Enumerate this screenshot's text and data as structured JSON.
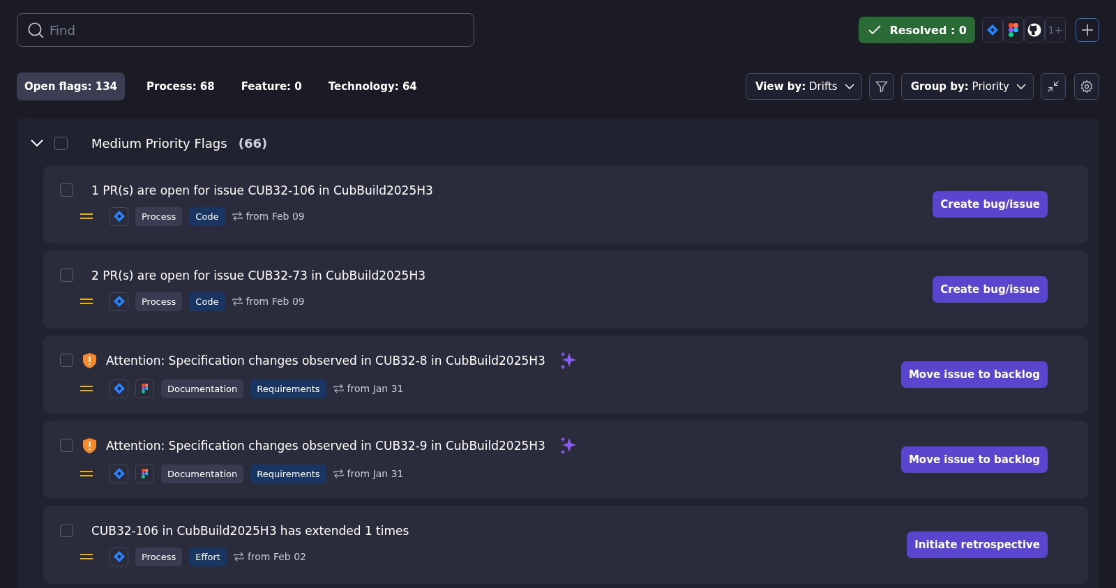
{
  "search": {
    "placeholder": "Find"
  },
  "resolved": {
    "label": "Resolved : 0"
  },
  "integrations": {
    "tools": [
      {
        "kind": "jira"
      },
      {
        "kind": "figma"
      },
      {
        "kind": "github"
      }
    ],
    "more": "1+"
  },
  "tabs": [
    {
      "label": "Open flags: 134",
      "selected": true
    },
    {
      "label": "Process: 68",
      "selected": false
    },
    {
      "label": "Feature: 0",
      "selected": false
    },
    {
      "label": "Technology: 64",
      "selected": false
    }
  ],
  "view_by": {
    "label": "View by:",
    "value": "Drifts"
  },
  "group_by": {
    "label": "Group by:",
    "value": "Priority"
  },
  "group": {
    "title": "Medium Priority Flags",
    "count": "(66)",
    "expanded": true,
    "checked": false,
    "flags": [
      {
        "title": "1 PR(s) are open for issue CUB32-106 in CubBuild2025H3",
        "checked": false,
        "attention": false,
        "ai": false,
        "sources": [
          {
            "kind": "jira"
          }
        ],
        "tags": [
          {
            "label": "Process",
            "kind": "category"
          },
          {
            "label": "Code",
            "kind": "type"
          }
        ],
        "since": "from Feb 09",
        "action": "Create bug/issue"
      },
      {
        "title": "2 PR(s) are open for issue CUB32-73 in CubBuild2025H3",
        "checked": false,
        "attention": false,
        "ai": false,
        "sources": [
          {
            "kind": "jira"
          }
        ],
        "tags": [
          {
            "label": "Process",
            "kind": "category"
          },
          {
            "label": "Code",
            "kind": "type"
          }
        ],
        "since": "from Feb 09",
        "action": "Create bug/issue"
      },
      {
        "title": "Attention: Specification changes observed in CUB32-8 in CubBuild2025H3",
        "checked": false,
        "attention": true,
        "ai": true,
        "sources": [
          {
            "kind": "jira"
          },
          {
            "kind": "figma"
          }
        ],
        "tags": [
          {
            "label": "Documentation",
            "kind": "category"
          },
          {
            "label": "Requirements",
            "kind": "type"
          }
        ],
        "since": "from Jan 31",
        "action": "Move issue to backlog"
      },
      {
        "title": "Attention: Specification changes observed in CUB32-9 in CubBuild2025H3",
        "checked": false,
        "attention": true,
        "ai": true,
        "sources": [
          {
            "kind": "jira"
          },
          {
            "kind": "figma"
          }
        ],
        "tags": [
          {
            "label": "Documentation",
            "kind": "category"
          },
          {
            "label": "Requirements",
            "kind": "type"
          }
        ],
        "since": "from Jan 31",
        "action": "Move issue to backlog"
      },
      {
        "title": "CUB32-106 in CubBuild2025H3 has extended 1 times",
        "checked": false,
        "attention": false,
        "ai": false,
        "sources": [
          {
            "kind": "jira"
          }
        ],
        "tags": [
          {
            "label": "Process",
            "kind": "category"
          },
          {
            "label": "Effort",
            "kind": "type"
          }
        ],
        "since": "from Feb 02",
        "action": "Initiate retrospective"
      }
    ]
  }
}
